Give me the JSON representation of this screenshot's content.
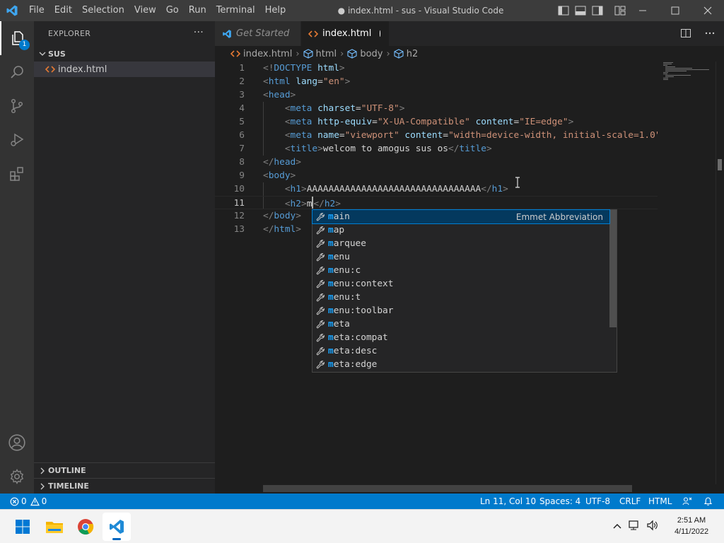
{
  "window": {
    "title": "● index.html - sus - Visual Studio Code"
  },
  "menu": [
    "File",
    "Edit",
    "Selection",
    "View",
    "Go",
    "Run",
    "Terminal",
    "Help"
  ],
  "activity": {
    "badge": "1"
  },
  "sidebar": {
    "header": "EXPLORER",
    "more": "···",
    "folder": "SUS",
    "files": [
      {
        "name": "index.html"
      }
    ],
    "outline": "OUTLINE",
    "timeline": "TIMELINE"
  },
  "tabs": [
    {
      "label": "Get Started"
    },
    {
      "label": "index.html"
    }
  ],
  "breadcrumb": [
    "index.html",
    "html",
    "body",
    "h2"
  ],
  "editor": {
    "line_numbers": [
      "1",
      "2",
      "3",
      "4",
      "5",
      "6",
      "7",
      "8",
      "9",
      "10",
      "11",
      "12",
      "13"
    ],
    "current_line": "11"
  },
  "suggest": {
    "items": [
      "main",
      "map",
      "marquee",
      "menu",
      "menu:c",
      "menu:context",
      "menu:t",
      "menu:toolbar",
      "meta",
      "meta:compat",
      "meta:desc",
      "meta:edge"
    ],
    "match": "m",
    "detail": "Emmet Abbreviation"
  },
  "status": {
    "errors": "0",
    "warnings": "0",
    "position": "Ln 11, Col 10",
    "spaces": "Spaces: 4",
    "encoding": "UTF-8",
    "eol": "CRLF",
    "language": "HTML"
  },
  "taskbar": {
    "time": "2:51 AM",
    "date": "4/11/2022"
  },
  "colors": {
    "accent": "#007acc",
    "tag": "#569cd6",
    "attribute": "#9cdcfe",
    "string": "#ce9178",
    "match": "#18a3ff"
  }
}
